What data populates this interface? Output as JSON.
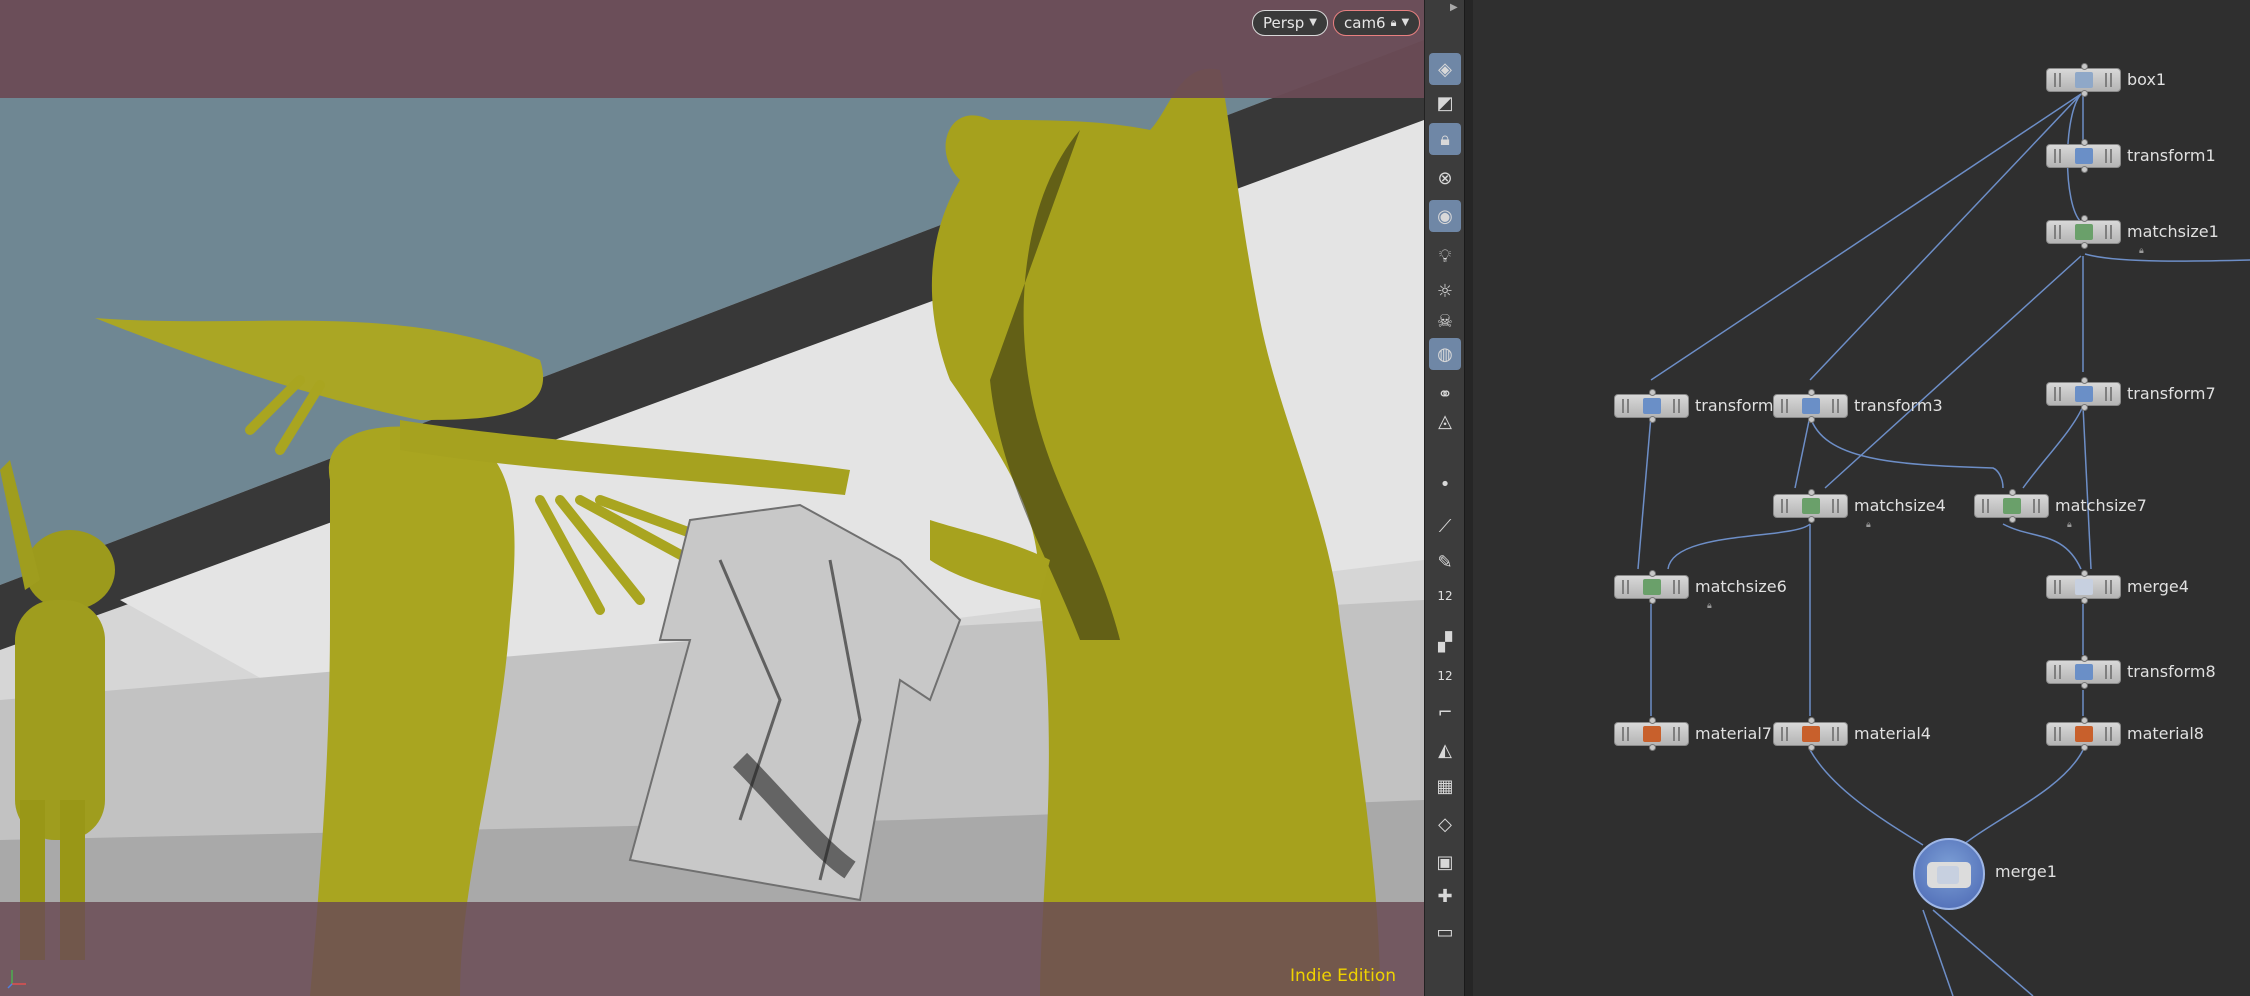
{
  "viewport": {
    "view_menu": "Persp",
    "camera_menu": "cam6",
    "watermark": "Indie Edition"
  },
  "shelf": {
    "tools": [
      {
        "icon": "scene-view-icon",
        "active": true
      },
      {
        "icon": "display-options-icon",
        "active": false
      },
      {
        "icon": "lock-camera-icon",
        "active": true
      },
      {
        "icon": "close-circle-icon",
        "active": false
      },
      {
        "icon": "snapping-icon",
        "active": true
      },
      {
        "icon": "light-bulb-icon",
        "active": false
      },
      {
        "icon": "headlight-icon",
        "active": false
      },
      {
        "icon": "skull-icon",
        "active": false
      },
      {
        "icon": "ghost-objects-icon",
        "active": true
      },
      {
        "icon": "vis-glasses-icon",
        "active": false
      },
      {
        "icon": "render-region-icon",
        "active": false
      },
      {
        "icon": "point-icon",
        "active": false
      },
      {
        "icon": "brush-icon",
        "active": false
      },
      {
        "icon": "pen-icon",
        "active": false
      },
      {
        "icon": "point-numbers-icon",
        "active": false,
        "text": "12"
      },
      {
        "icon": "paint-icon",
        "active": false
      },
      {
        "icon": "primitive-numbers-icon",
        "active": false,
        "text": "12"
      },
      {
        "icon": "curve-icon",
        "active": false
      },
      {
        "icon": "sculpt-icon",
        "active": false
      },
      {
        "icon": "texture-grid-icon",
        "active": false
      },
      {
        "icon": "uv-icon",
        "active": false
      },
      {
        "icon": "uv-green-icon",
        "active": false
      },
      {
        "icon": "handle-icon",
        "active": false
      },
      {
        "icon": "box-frame-icon",
        "active": false
      }
    ]
  },
  "network": {
    "nodes": [
      {
        "id": "box1",
        "label": "box1",
        "type": "box"
      },
      {
        "id": "transform1",
        "label": "transform1",
        "type": "transform"
      },
      {
        "id": "matchsize1",
        "label": "matchsize1",
        "type": "matchsize",
        "locked": true
      },
      {
        "id": "transform5",
        "label": "transform5",
        "type": "transform"
      },
      {
        "id": "transform3",
        "label": "transform3",
        "type": "transform"
      },
      {
        "id": "transform7",
        "label": "transform7",
        "type": "transform"
      },
      {
        "id": "matchsize4",
        "label": "matchsize4",
        "type": "matchsize",
        "locked": true
      },
      {
        "id": "matchsize7",
        "label": "matchsize7",
        "type": "matchsize",
        "locked": true
      },
      {
        "id": "matchsize6",
        "label": "matchsize6",
        "type": "matchsize",
        "locked": true
      },
      {
        "id": "merge4",
        "label": "merge4",
        "type": "merge"
      },
      {
        "id": "transform8",
        "label": "transform8",
        "type": "transform"
      },
      {
        "id": "material7",
        "label": "material7",
        "type": "material"
      },
      {
        "id": "material4",
        "label": "material4",
        "type": "material"
      },
      {
        "id": "material8",
        "label": "material8",
        "type": "material"
      },
      {
        "id": "merge1",
        "label": "merge1",
        "type": "merge",
        "display": true
      }
    ]
  }
}
